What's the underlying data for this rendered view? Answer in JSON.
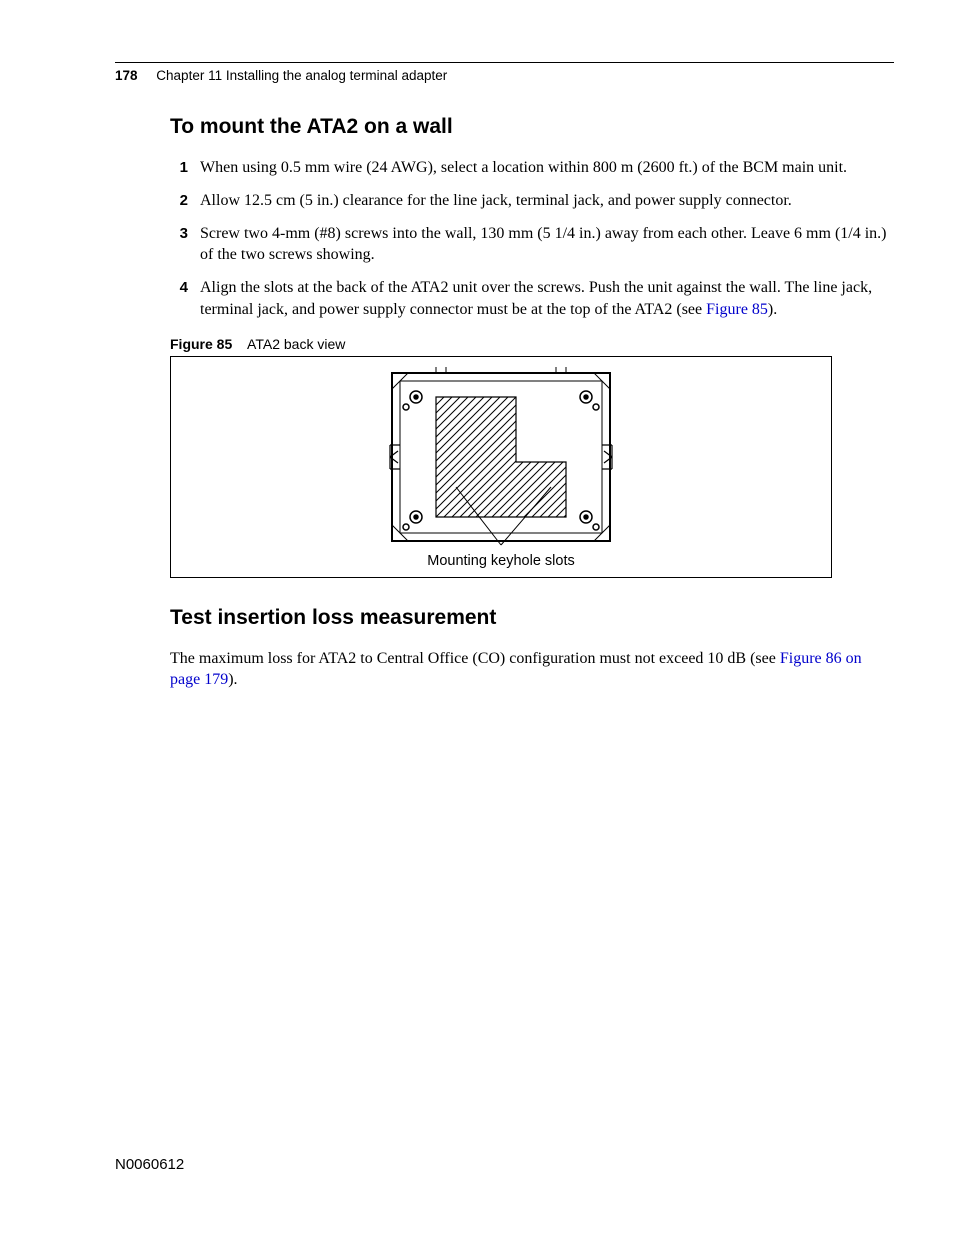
{
  "header": {
    "page_number": "178",
    "chapter": "Chapter 11  Installing the analog terminal adapter"
  },
  "section1": {
    "title": "To mount the ATA2 on a wall",
    "steps": [
      {
        "n": "1",
        "text": "When using 0.5 mm wire (24 AWG), select a location within 800 m (2600 ft.) of the BCM main unit."
      },
      {
        "n": "2",
        "text": "Allow 12.5 cm (5 in.) clearance for the line jack, terminal jack, and power supply connector."
      },
      {
        "n": "3",
        "text": "Screw two 4-mm (#8) screws into the wall, 130 mm (5 1/4 in.) away from each other. Leave 6 mm (1/4 in.) of the two screws showing."
      },
      {
        "n": "4",
        "text_before": "Align the slots at the back of the ATA2 unit over the screws. Push the unit against the wall. The line jack, terminal jack, and power supply connector must be at the top of the ATA2 (see ",
        "link": "Figure 85",
        "text_after": ")."
      }
    ]
  },
  "figure": {
    "label": "Figure 85",
    "title": "ATA2 back view",
    "annotation": "Mounting keyhole slots"
  },
  "section2": {
    "title": "Test insertion loss measurement",
    "paragraph": {
      "text_before": "The maximum loss for ATA2 to Central Office (CO) configuration must not exceed 10 dB (see ",
      "link": "Figure 86 on page 179",
      "text_after": ")."
    }
  },
  "footer": {
    "doc_number": "N0060612"
  }
}
